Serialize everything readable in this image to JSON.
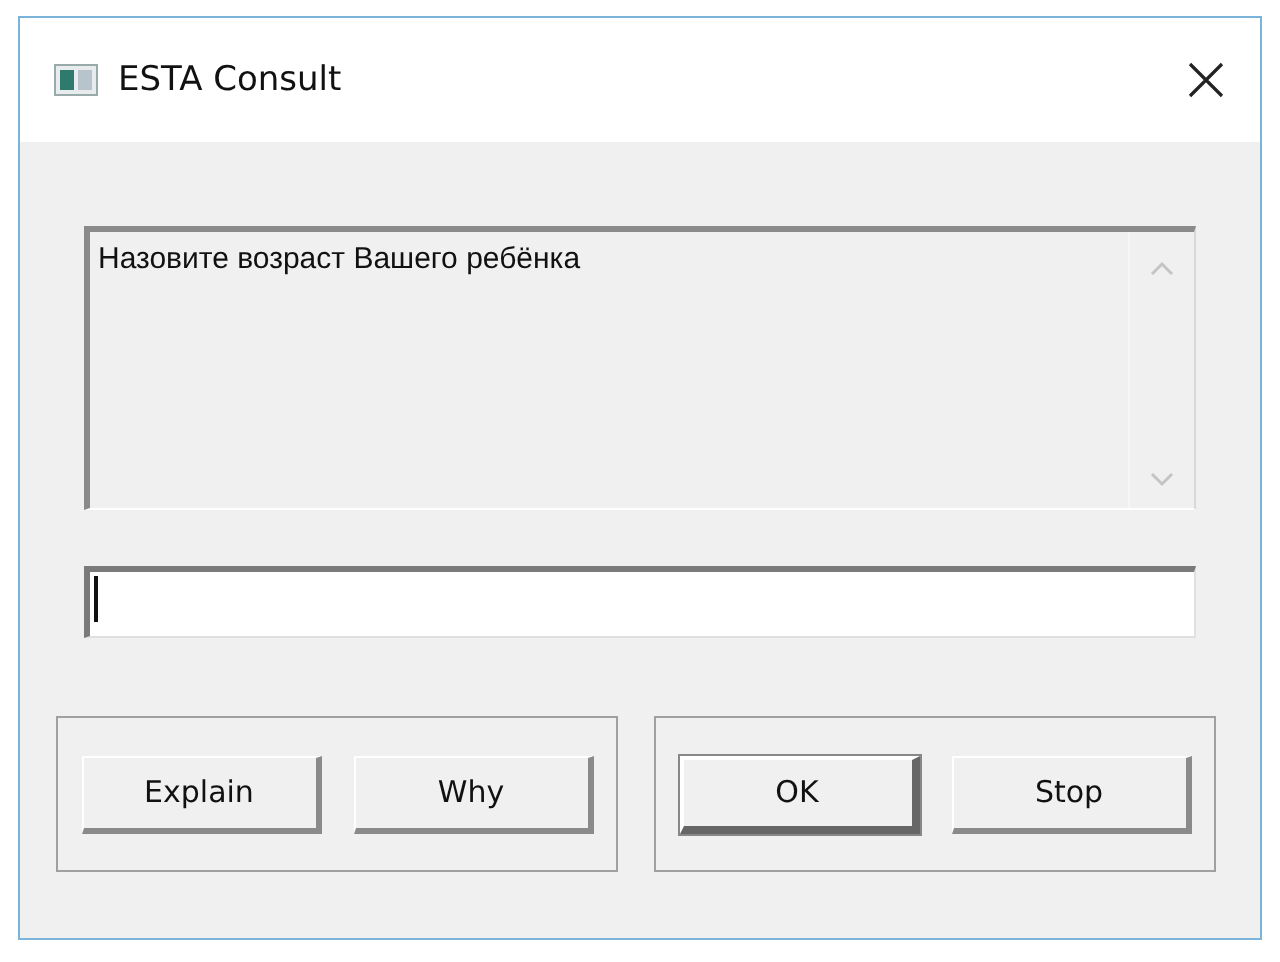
{
  "window": {
    "title": "ESTA Consult"
  },
  "message": {
    "text": "Назовите возраст Вашего ребёнка"
  },
  "button_groups": [
    {
      "buttons": [
        {
          "label": "Explain",
          "default": false
        },
        {
          "label": "Why",
          "default": false
        }
      ]
    },
    {
      "buttons": [
        {
          "label": "OK",
          "default": true
        },
        {
          "label": "Stop",
          "default": false
        }
      ]
    }
  ]
}
